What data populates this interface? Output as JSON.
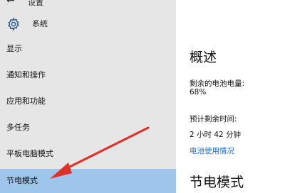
{
  "window": {
    "back_glyph": "←",
    "title": "设置"
  },
  "header": {
    "icon": "gear-icon",
    "title": "系统"
  },
  "sidebar": {
    "items": [
      {
        "label": "显示"
      },
      {
        "label": "通知和操作"
      },
      {
        "label": "应用和功能"
      },
      {
        "label": "多任务"
      },
      {
        "label": "平板电脑模式"
      },
      {
        "label": "节电模式",
        "selected": true
      }
    ],
    "selected_color": "#9ec5ea"
  },
  "main": {
    "overview_title": "概述",
    "battery_label": "剩余的电池电量:",
    "battery_value": "68%",
    "time_label": "预计剩余时间:",
    "time_value": "2 小时 42 分钟",
    "usage_link": "电池使用情况",
    "battery_saver_title": "节电模式"
  },
  "annotation": {
    "arrow_color": "#e0302a"
  }
}
